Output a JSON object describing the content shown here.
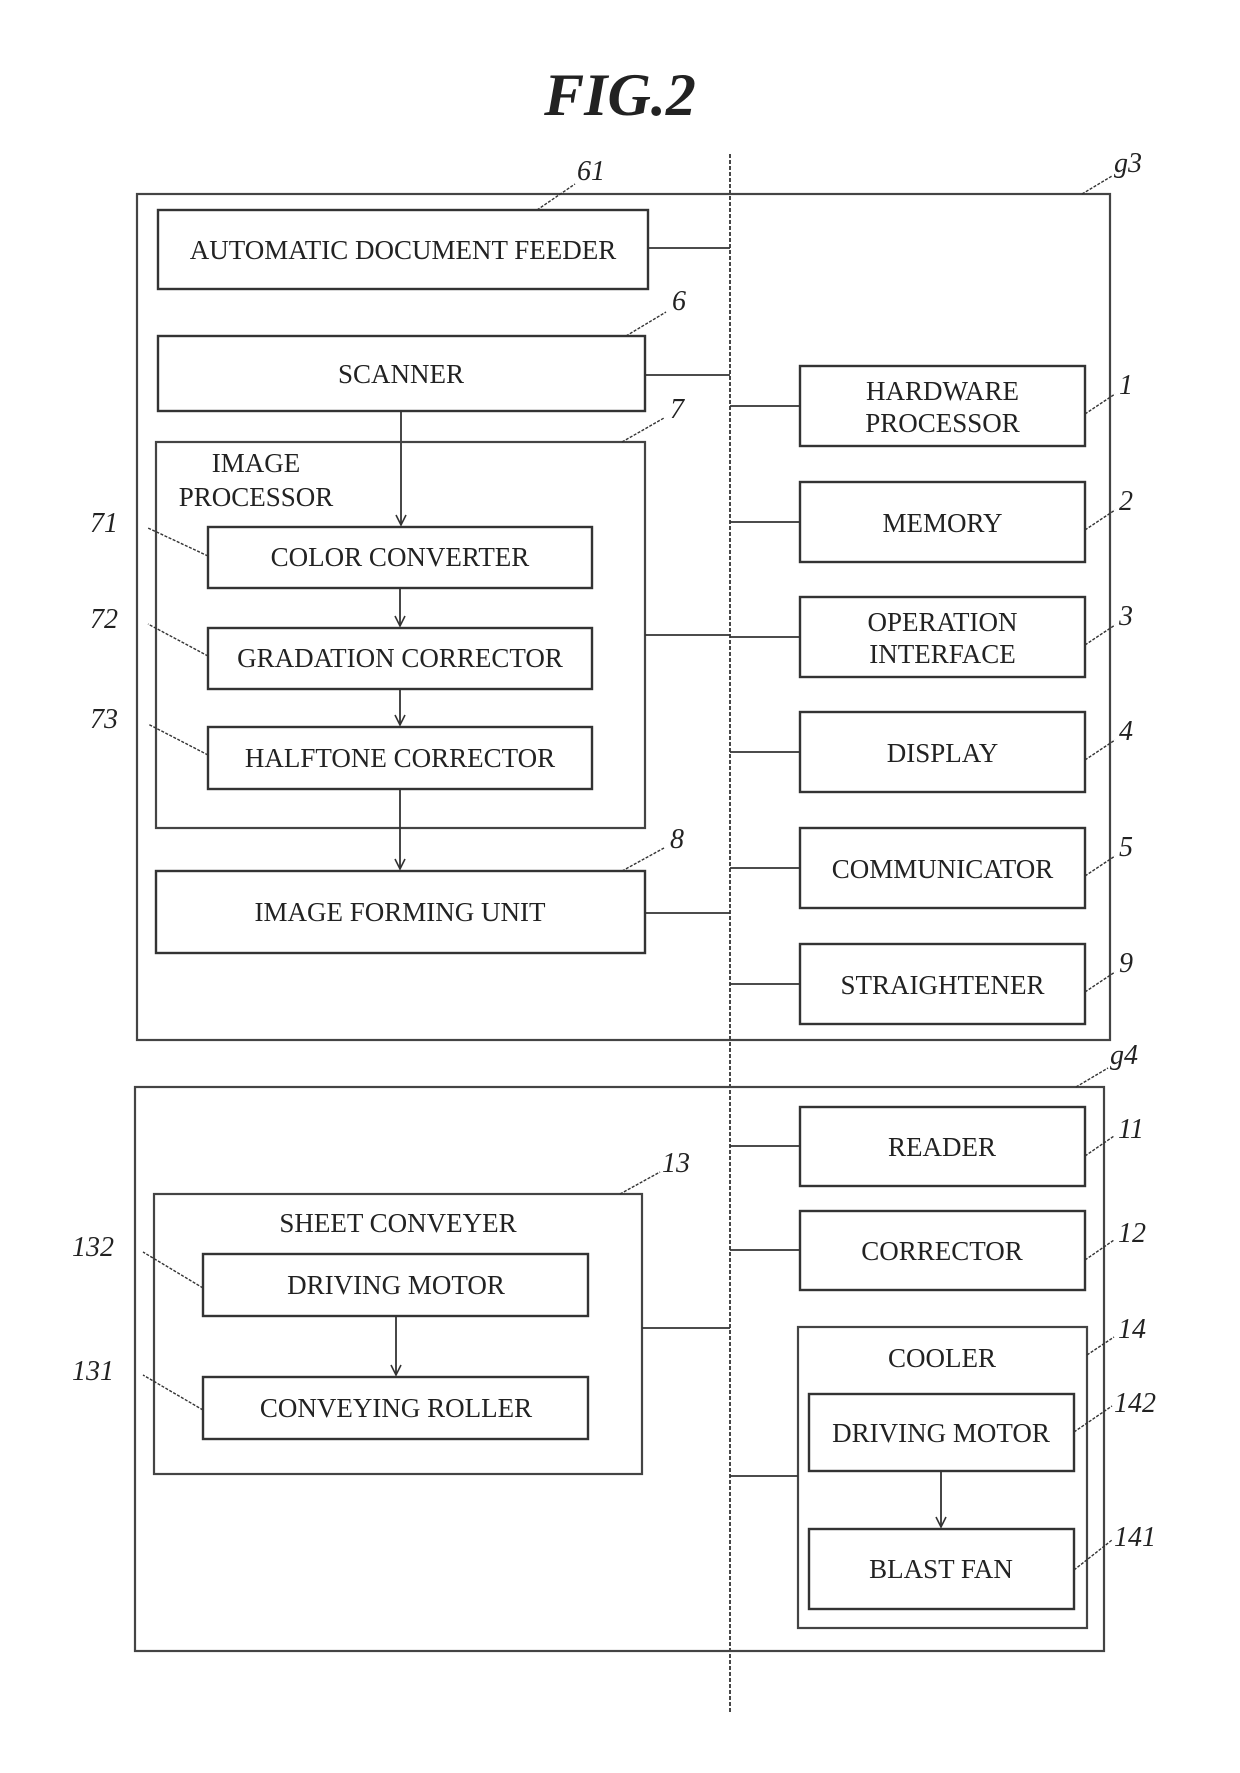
{
  "figure": {
    "title": "FIG.2"
  },
  "groups": {
    "g3": {
      "ref": "g3"
    },
    "g4": {
      "ref": "g4"
    }
  },
  "left_upper": {
    "adf": {
      "label": "AUTOMATIC DOCUMENT FEEDER",
      "ref": "61"
    },
    "scanner": {
      "label": "SCANNER",
      "ref": "6"
    },
    "image_processor": {
      "label_line1": "IMAGE",
      "label_line2": "PROCESSOR",
      "ref": "7",
      "children": [
        {
          "label": "COLOR CONVERTER",
          "ref": "71"
        },
        {
          "label": "GRADATION CORRECTOR",
          "ref": "72"
        },
        {
          "label": "HALFTONE CORRECTOR",
          "ref": "73"
        }
      ]
    },
    "image_forming_unit": {
      "label": "IMAGE FORMING UNIT",
      "ref": "8"
    }
  },
  "right_upper": [
    {
      "label_line1": "HARDWARE",
      "label_line2": "PROCESSOR",
      "ref": "1"
    },
    {
      "label_line1": "MEMORY",
      "label_line2": "",
      "ref": "2"
    },
    {
      "label_line1": "OPERATION",
      "label_line2": "INTERFACE",
      "ref": "3"
    },
    {
      "label_line1": "DISPLAY",
      "label_line2": "",
      "ref": "4"
    },
    {
      "label_line1": "COMMUNICATOR",
      "label_line2": "",
      "ref": "5"
    },
    {
      "label_line1": "STRAIGHTENER",
      "label_line2": "",
      "ref": "9"
    }
  ],
  "left_lower": {
    "sheet_conveyer": {
      "label": "SHEET CONVEYER",
      "ref": "13",
      "children": [
        {
          "label": "DRIVING MOTOR",
          "ref": "132"
        },
        {
          "label": "CONVEYING ROLLER",
          "ref": "131"
        }
      ]
    }
  },
  "right_lower": {
    "reader": {
      "label": "READER",
      "ref": "11"
    },
    "corrector": {
      "label": "CORRECTOR",
      "ref": "12"
    },
    "cooler": {
      "label": "COOLER",
      "ref": "14",
      "children": [
        {
          "label": "DRIVING MOTOR",
          "ref": "142"
        },
        {
          "label": "BLAST FAN",
          "ref": "141"
        }
      ]
    }
  }
}
